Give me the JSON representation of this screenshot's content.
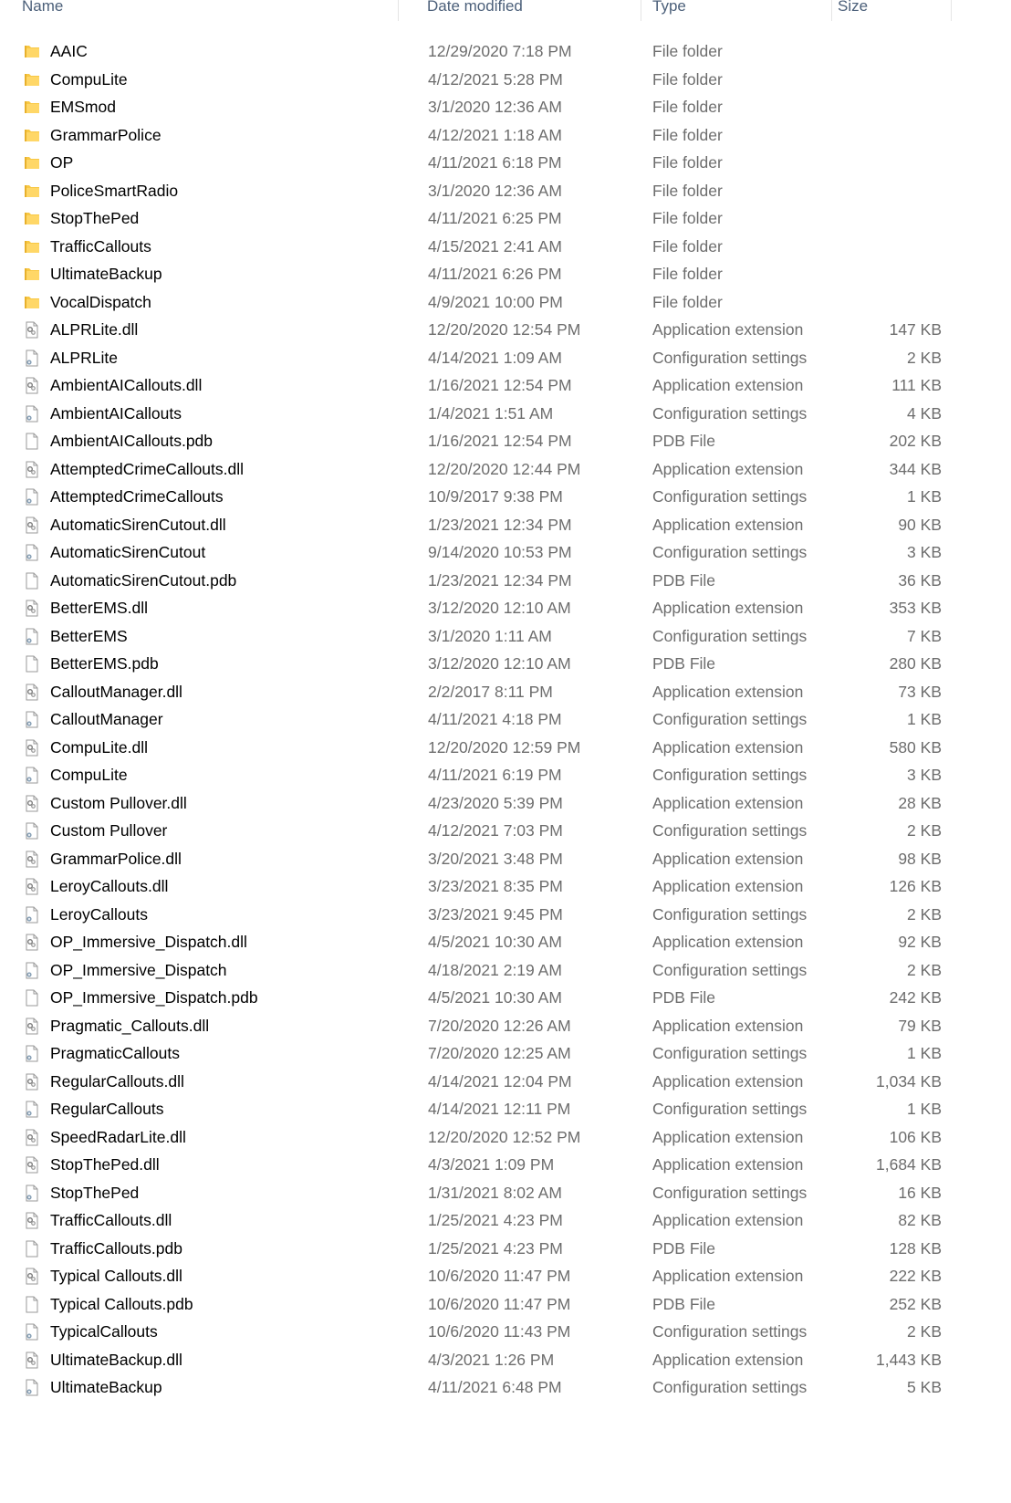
{
  "columns": {
    "name": "Name",
    "date": "Date modified",
    "type": "Type",
    "size": "Size"
  },
  "colors": {
    "folder": "#f8c844",
    "header_text": "#4c607a",
    "secondary_text": "#6d6d6d"
  },
  "files": [
    {
      "name": "AAIC",
      "date": "12/29/2020 7:18 PM",
      "type": "File folder",
      "size": "",
      "icon": "folder-icon"
    },
    {
      "name": "CompuLite",
      "date": "4/12/2021 5:28 PM",
      "type": "File folder",
      "size": "",
      "icon": "folder-icon"
    },
    {
      "name": "EMSmod",
      "date": "3/1/2020 12:36 AM",
      "type": "File folder",
      "size": "",
      "icon": "folder-icon"
    },
    {
      "name": "GrammarPolice",
      "date": "4/12/2021 1:18 AM",
      "type": "File folder",
      "size": "",
      "icon": "folder-icon"
    },
    {
      "name": "OP",
      "date": "4/11/2021 6:18 PM",
      "type": "File folder",
      "size": "",
      "icon": "folder-icon"
    },
    {
      "name": "PoliceSmartRadio",
      "date": "3/1/2020 12:36 AM",
      "type": "File folder",
      "size": "",
      "icon": "folder-icon"
    },
    {
      "name": "StopThePed",
      "date": "4/11/2021 6:25 PM",
      "type": "File folder",
      "size": "",
      "icon": "folder-icon"
    },
    {
      "name": "TrafficCallouts",
      "date": "4/15/2021 2:41 AM",
      "type": "File folder",
      "size": "",
      "icon": "folder-icon"
    },
    {
      "name": "UltimateBackup",
      "date": "4/11/2021 6:26 PM",
      "type": "File folder",
      "size": "",
      "icon": "folder-icon"
    },
    {
      "name": "VocalDispatch",
      "date": "4/9/2021 10:00 PM",
      "type": "File folder",
      "size": "",
      "icon": "folder-icon"
    },
    {
      "name": "ALPRLite.dll",
      "date": "12/20/2020 12:54 PM",
      "type": "Application extension",
      "size": "147 KB",
      "icon": "dll-icon"
    },
    {
      "name": "ALPRLite",
      "date": "4/14/2021 1:09 AM",
      "type": "Configuration settings",
      "size": "2 KB",
      "icon": "config-icon"
    },
    {
      "name": "AmbientAICallouts.dll",
      "date": "1/16/2021 12:54 PM",
      "type": "Application extension",
      "size": "111 KB",
      "icon": "dll-icon"
    },
    {
      "name": "AmbientAICallouts",
      "date": "1/4/2021 1:51 AM",
      "type": "Configuration settings",
      "size": "4 KB",
      "icon": "config-icon"
    },
    {
      "name": "AmbientAICallouts.pdb",
      "date": "1/16/2021 12:54 PM",
      "type": "PDB File",
      "size": "202 KB",
      "icon": "file-icon"
    },
    {
      "name": "AttemptedCrimeCallouts.dll",
      "date": "12/20/2020 12:44 PM",
      "type": "Application extension",
      "size": "344 KB",
      "icon": "dll-icon"
    },
    {
      "name": "AttemptedCrimeCallouts",
      "date": "10/9/2017 9:38 PM",
      "type": "Configuration settings",
      "size": "1 KB",
      "icon": "config-icon"
    },
    {
      "name": "AutomaticSirenCutout.dll",
      "date": "1/23/2021 12:34 PM",
      "type": "Application extension",
      "size": "90 KB",
      "icon": "dll-icon"
    },
    {
      "name": "AutomaticSirenCutout",
      "date": "9/14/2020 10:53 PM",
      "type": "Configuration settings",
      "size": "3 KB",
      "icon": "config-icon"
    },
    {
      "name": "AutomaticSirenCutout.pdb",
      "date": "1/23/2021 12:34 PM",
      "type": "PDB File",
      "size": "36 KB",
      "icon": "file-icon"
    },
    {
      "name": "BetterEMS.dll",
      "date": "3/12/2020 12:10 AM",
      "type": "Application extension",
      "size": "353 KB",
      "icon": "dll-icon"
    },
    {
      "name": "BetterEMS",
      "date": "3/1/2020 1:11 AM",
      "type": "Configuration settings",
      "size": "7 KB",
      "icon": "config-icon"
    },
    {
      "name": "BetterEMS.pdb",
      "date": "3/12/2020 12:10 AM",
      "type": "PDB File",
      "size": "280 KB",
      "icon": "file-icon"
    },
    {
      "name": "CalloutManager.dll",
      "date": "2/2/2017 8:11 PM",
      "type": "Application extension",
      "size": "73 KB",
      "icon": "dll-icon"
    },
    {
      "name": "CalloutManager",
      "date": "4/11/2021 4:18 PM",
      "type": "Configuration settings",
      "size": "1 KB",
      "icon": "config-icon"
    },
    {
      "name": "CompuLite.dll",
      "date": "12/20/2020 12:59 PM",
      "type": "Application extension",
      "size": "580 KB",
      "icon": "dll-icon"
    },
    {
      "name": "CompuLite",
      "date": "4/11/2021 6:19 PM",
      "type": "Configuration settings",
      "size": "3 KB",
      "icon": "config-icon"
    },
    {
      "name": "Custom Pullover.dll",
      "date": "4/23/2020 5:39 PM",
      "type": "Application extension",
      "size": "28 KB",
      "icon": "dll-icon"
    },
    {
      "name": "Custom Pullover",
      "date": "4/12/2021 7:03 PM",
      "type": "Configuration settings",
      "size": "2 KB",
      "icon": "config-icon"
    },
    {
      "name": "GrammarPolice.dll",
      "date": "3/20/2021 3:48 PM",
      "type": "Application extension",
      "size": "98 KB",
      "icon": "dll-icon"
    },
    {
      "name": "LeroyCallouts.dll",
      "date": "3/23/2021 8:35 PM",
      "type": "Application extension",
      "size": "126 KB",
      "icon": "dll-icon"
    },
    {
      "name": "LeroyCallouts",
      "date": "3/23/2021 9:45 PM",
      "type": "Configuration settings",
      "size": "2 KB",
      "icon": "config-icon"
    },
    {
      "name": "OP_Immersive_Dispatch.dll",
      "date": "4/5/2021 10:30 AM",
      "type": "Application extension",
      "size": "92 KB",
      "icon": "dll-icon"
    },
    {
      "name": "OP_Immersive_Dispatch",
      "date": "4/18/2021 2:19 AM",
      "type": "Configuration settings",
      "size": "2 KB",
      "icon": "config-icon"
    },
    {
      "name": "OP_Immersive_Dispatch.pdb",
      "date": "4/5/2021 10:30 AM",
      "type": "PDB File",
      "size": "242 KB",
      "icon": "file-icon"
    },
    {
      "name": "Pragmatic_Callouts.dll",
      "date": "7/20/2020 12:26 AM",
      "type": "Application extension",
      "size": "79 KB",
      "icon": "dll-icon"
    },
    {
      "name": "PragmaticCallouts",
      "date": "7/20/2020 12:25 AM",
      "type": "Configuration settings",
      "size": "1 KB",
      "icon": "config-icon"
    },
    {
      "name": "RegularCallouts.dll",
      "date": "4/14/2021 12:04 PM",
      "type": "Application extension",
      "size": "1,034 KB",
      "icon": "dll-icon"
    },
    {
      "name": "RegularCallouts",
      "date": "4/14/2021 12:11 PM",
      "type": "Configuration settings",
      "size": "1 KB",
      "icon": "config-icon"
    },
    {
      "name": "SpeedRadarLite.dll",
      "date": "12/20/2020 12:52 PM",
      "type": "Application extension",
      "size": "106 KB",
      "icon": "dll-icon"
    },
    {
      "name": "StopThePed.dll",
      "date": "4/3/2021 1:09 PM",
      "type": "Application extension",
      "size": "1,684 KB",
      "icon": "dll-icon"
    },
    {
      "name": "StopThePed",
      "date": "1/31/2021 8:02 AM",
      "type": "Configuration settings",
      "size": "16 KB",
      "icon": "config-icon"
    },
    {
      "name": "TrafficCallouts.dll",
      "date": "1/25/2021 4:23 PM",
      "type": "Application extension",
      "size": "82 KB",
      "icon": "dll-icon"
    },
    {
      "name": "TrafficCallouts.pdb",
      "date": "1/25/2021 4:23 PM",
      "type": "PDB File",
      "size": "128 KB",
      "icon": "file-icon"
    },
    {
      "name": "Typical Callouts.dll",
      "date": "10/6/2020 11:47 PM",
      "type": "Application extension",
      "size": "222 KB",
      "icon": "dll-icon"
    },
    {
      "name": "Typical Callouts.pdb",
      "date": "10/6/2020 11:47 PM",
      "type": "PDB File",
      "size": "252 KB",
      "icon": "file-icon"
    },
    {
      "name": "TypicalCallouts",
      "date": "10/6/2020 11:43 PM",
      "type": "Configuration settings",
      "size": "2 KB",
      "icon": "config-icon"
    },
    {
      "name": "UltimateBackup.dll",
      "date": "4/3/2021 1:26 PM",
      "type": "Application extension",
      "size": "1,443 KB",
      "icon": "dll-icon"
    },
    {
      "name": "UltimateBackup",
      "date": "4/11/2021 6:48 PM",
      "type": "Configuration settings",
      "size": "5 KB",
      "icon": "config-icon"
    }
  ]
}
